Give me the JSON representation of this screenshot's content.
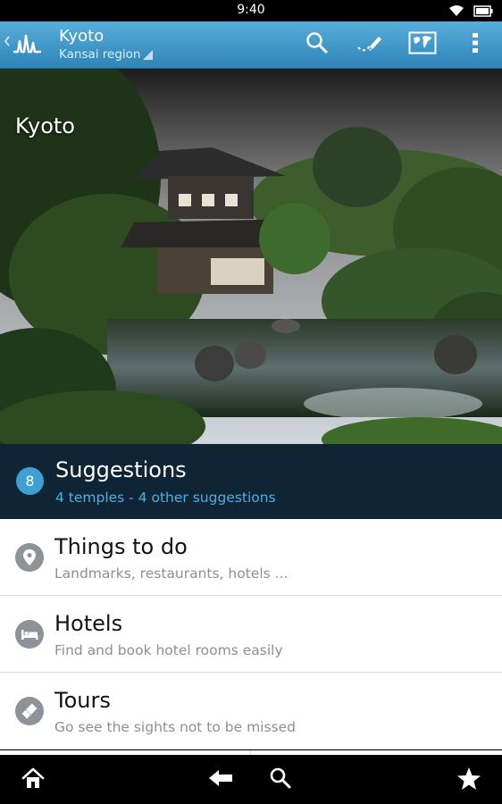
{
  "status_bar": {
    "time": "9:40",
    "icons": [
      "wifi-icon",
      "battery-icon"
    ]
  },
  "action_bar": {
    "title": "Kyoto",
    "subtitle": "Kansai region",
    "actions": [
      "search-icon",
      "route-icon",
      "map-icon",
      "overflow-menu-icon"
    ]
  },
  "hero": {
    "title": "Kyoto"
  },
  "suggestions": {
    "count": "8",
    "title": "Suggestions",
    "subtitle": "4 temples - 4 other suggestions"
  },
  "menu": [
    {
      "title": "Things to do",
      "subtitle": "Landmarks, restaurants, hotels ...",
      "icon": "location-pin-icon"
    },
    {
      "title": "Hotels",
      "subtitle": "Find and book hotel rooms easily",
      "icon": "bed-icon"
    },
    {
      "title": "Tours",
      "subtitle": "Go see the sights not to be missed",
      "icon": "ticket-icon"
    }
  ],
  "bottom_nav": [
    "home-icon",
    "back-icon",
    "search-icon",
    "favorites-icon"
  ],
  "colors": {
    "action_bar": "#3b93c6",
    "badge": "#3f9fd3",
    "suggestion_bg": "#0f2434",
    "suggestion_sub": "#4ab0e6"
  }
}
